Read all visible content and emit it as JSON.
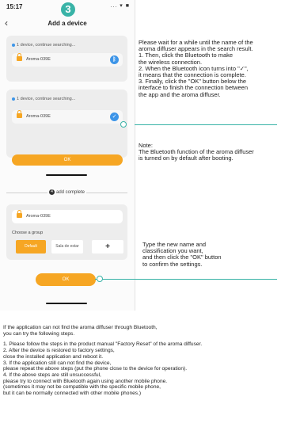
{
  "status": {
    "time": "15:17",
    "icons": "... ▾ ■"
  },
  "step_number": "3",
  "nav": {
    "title": "Add a device"
  },
  "search1": {
    "text": "1 device,  continue searching...",
    "device": "Aroma-039E"
  },
  "search2": {
    "text": "1 device,  continue searching...",
    "device": "Aroma-039E"
  },
  "ok_label": "OK",
  "complete": {
    "badge": "4",
    "label": "add complete"
  },
  "edit": {
    "device_value": "Aroma-039E",
    "group_label": "Choose a group",
    "groups": [
      "Default",
      "Sala de estar",
      "+"
    ],
    "ok_label": "OK"
  },
  "instructions_top": [
    "Please wait for a while until the name of the",
    "aroma diffuser appears in the search result.",
    "1. Then, click the Bluetooth to make",
    "    the wireless connection.",
    "2. When the Bluetooth icon turns into \"✓\",",
    "    it means that the connection is complete.",
    "3. Finally, click the \"OK\" button below the",
    "    interface to finish the connection between",
    "    the app and the aroma diffuser."
  ],
  "note": [
    "Note:",
    "The Bluetooth function of the aroma diffuser",
    "is turned on by default after booting."
  ],
  "instructions_mid": [
    "Type the new name and",
    "classification you want,",
    "and then click the \"OK\" button",
    "to confirm the settings."
  ],
  "bottom_text": [
    "If the application can not find the aroma diffuser through Bluetooth,",
    "you can try the following steps.",
    "",
    "1. Please follow the steps in the product manual \"Factory Reset\" of the aroma diffuser.",
    "2. After the device is restored to factory settings,",
    "    close the installed application and reboot it.",
    "3. If the application still can not find the device,",
    "    please repeat the above steps (put the phone close to the device for operation).",
    "4. If the above steps are still unsuccessful,",
    "    please try to connect with Bluetooth again using another mobile phone.",
    "   (sometimes it may not be compatible with the specific mobile phone,",
    "   but it can be normally connected with other mobile phones.)"
  ]
}
